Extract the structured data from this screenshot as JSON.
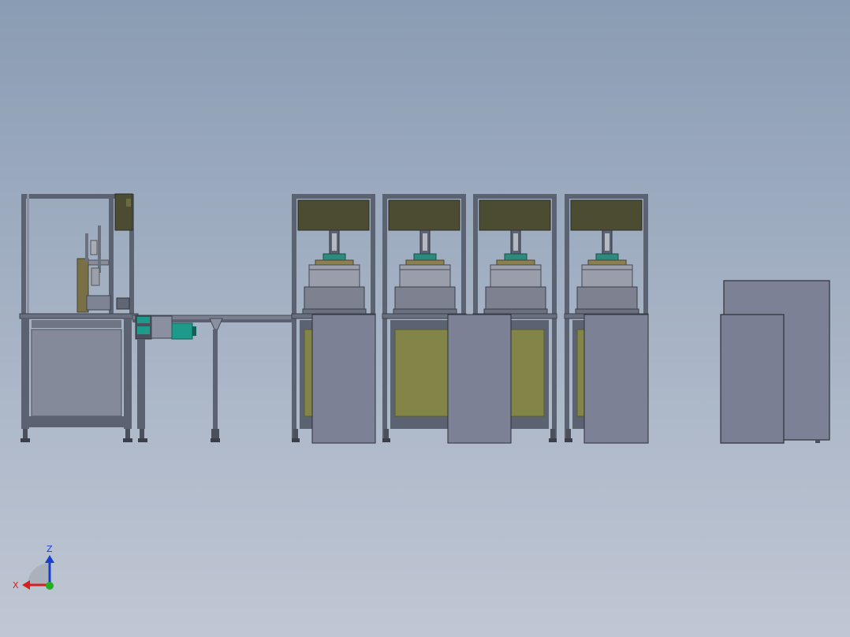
{
  "view": {
    "background_top": "#8a9cb3",
    "background_bottom": "#c0c7d4"
  },
  "model": {
    "frame_color": "#5b6373",
    "panel_color": "#7d8195",
    "olive_color": "#4c4c33",
    "yellow_panel_color": "#838548",
    "motor_color": "#1e9a8a",
    "stations": 4
  },
  "triad": {
    "x_label": "X",
    "z_label": "Z",
    "x_color": "#d42020",
    "z_color": "#1a3fd0",
    "y_color": "#20b020"
  }
}
